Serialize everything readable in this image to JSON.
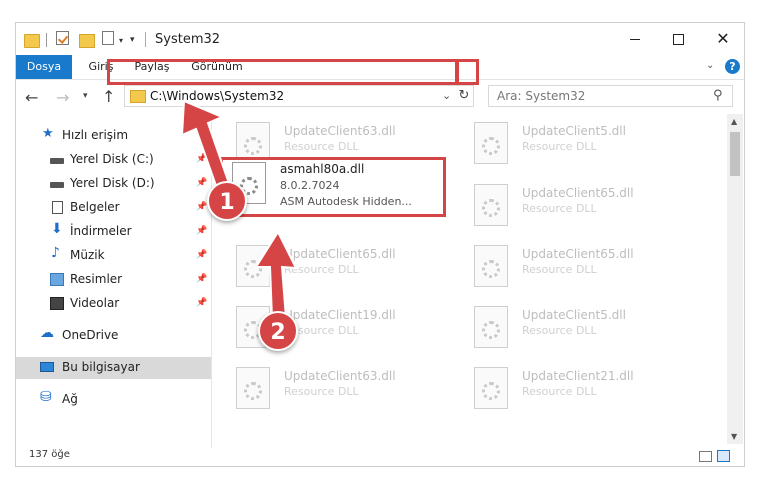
{
  "window": {
    "title": "System32",
    "controls": {
      "minimize": "",
      "maximize": "",
      "close": "✕"
    }
  },
  "ribbon": {
    "tabs": [
      "Dosya",
      "Giriş",
      "Paylaş",
      "Görünüm"
    ],
    "help": "?"
  },
  "nav": {
    "address": "C:\\Windows\\System32",
    "search_placeholder": "Ara: System32"
  },
  "sidebar": {
    "items": [
      {
        "label": "Hızlı erişim",
        "icon": "star-icon",
        "pinned": false
      },
      {
        "label": "Yerel Disk (C:)",
        "icon": "disk-icon",
        "pinned": true
      },
      {
        "label": "Yerel Disk (D:)",
        "icon": "disk-icon",
        "pinned": true
      },
      {
        "label": "Belgeler",
        "icon": "documents-icon",
        "pinned": true
      },
      {
        "label": "İndirmeler",
        "icon": "download-icon",
        "pinned": true
      },
      {
        "label": "Müzik",
        "icon": "music-icon",
        "pinned": true
      },
      {
        "label": "Resimler",
        "icon": "pictures-icon",
        "pinned": true
      },
      {
        "label": "Videolar",
        "icon": "videos-icon",
        "pinned": true
      },
      {
        "label": "OneDrive",
        "icon": "cloud-icon",
        "pinned": false
      },
      {
        "label": "Bu bilgisayar",
        "icon": "computer-icon",
        "pinned": false,
        "selected": true
      },
      {
        "label": "Ağ",
        "icon": "network-icon",
        "pinned": false
      }
    ]
  },
  "files": [
    {
      "name": "UpdateClient63.dll",
      "desc": "Resource DLL"
    },
    {
      "name": "UpdateClient5.dll",
      "desc": "Resource DLL"
    },
    {
      "name": "UpdateClient65.dll",
      "desc": "Resource DLL"
    },
    {
      "name": "UpdateClient65.dll",
      "desc": "Resource DLL"
    },
    {
      "name": "UpdateClient65.dll",
      "desc": "Resource DLL"
    },
    {
      "name": "UpdateClient19.dll",
      "desc": "Resource DLL"
    },
    {
      "name": "UpdateClient5.dll",
      "desc": "Resource DLL"
    },
    {
      "name": "UpdateClient63.dll",
      "desc": "Resource DLL"
    },
    {
      "name": "UpdateClient21.dll",
      "desc": "Resource DLL"
    }
  ],
  "focus_file": {
    "name": "asmahl80a.dll",
    "version": "8.0.2.7024",
    "desc": "ASM Autodesk Hidden..."
  },
  "status": {
    "count": "137 öğe"
  },
  "callouts": {
    "one": "1",
    "two": "2"
  },
  "colors": {
    "accent": "#1979ca",
    "highlight": "#d64545"
  }
}
